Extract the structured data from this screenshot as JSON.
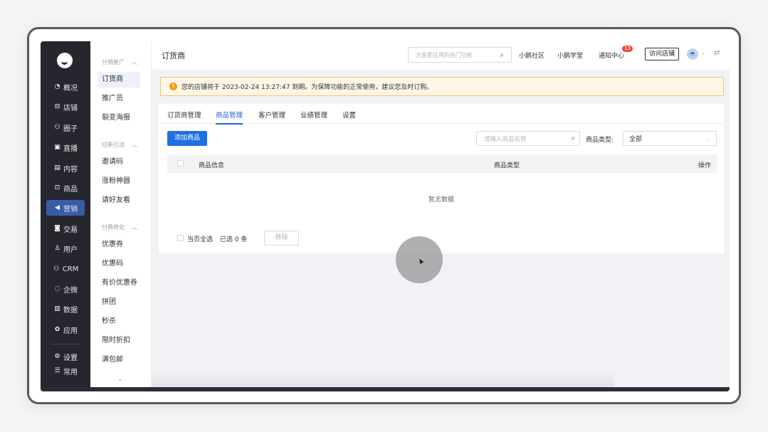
{
  "nav": {
    "items": [
      {
        "icon": "◔",
        "label": "概况"
      },
      {
        "icon": "⊟",
        "label": "店铺"
      },
      {
        "icon": "⚇",
        "label": "圈子"
      },
      {
        "icon": "▣",
        "label": "直播"
      },
      {
        "icon": "▤",
        "label": "内容"
      },
      {
        "icon": "⊡",
        "label": "商品"
      },
      {
        "icon": "◀",
        "label": "营销"
      },
      {
        "icon": "◙",
        "label": "交易"
      },
      {
        "icon": "♙",
        "label": "用户"
      },
      {
        "icon": "⚇",
        "label": "CRM"
      },
      {
        "icon": "◌",
        "label": "企微"
      },
      {
        "icon": "▥",
        "label": "数据"
      },
      {
        "icon": "✿",
        "label": "应用"
      },
      {
        "icon": "⚙",
        "label": "设置"
      },
      {
        "icon": "☰",
        "label": "常用"
      }
    ],
    "active_index": 6
  },
  "submenu": {
    "groups": [
      {
        "title": "分销推广",
        "items": [
          "订货商",
          "推广员",
          "裂变海报"
        ]
      },
      {
        "title": "拉新引流",
        "items": [
          "邀请码",
          "涨粉神器",
          "请好友看"
        ]
      },
      {
        "title": "付费转化",
        "items": [
          "优惠券",
          "优惠码",
          "有价优惠券",
          "拼团",
          "秒杀",
          "限时折扣",
          "满包邮"
        ]
      }
    ],
    "active": "订货商",
    "more_icon": "⌄"
  },
  "header": {
    "title": "订货商",
    "search_placeholder": "大家都在用的热门功能",
    "links": [
      "小鹅社区",
      "小鹅学堂",
      "通知中心"
    ],
    "notice_count": "13",
    "visit_store": "访问店铺"
  },
  "notice": {
    "text": "您的店铺将于 2023-02-24 13:27:47 到期。为保障功能的正常使用，建议您及时订购。",
    "icon": "!"
  },
  "tabs": [
    "订货商管理",
    "商品管理",
    "客户管理",
    "业绩管理",
    "设置"
  ],
  "active_tab": "商品管理",
  "toolbar": {
    "add_label": "添加商品",
    "search_placeholder": "请输入商品名称",
    "type_label": "商品类型:",
    "type_value": "全部"
  },
  "table": {
    "columns": [
      "商品信息",
      "商品类型",
      "操作"
    ],
    "empty_text": "暂无数据"
  },
  "footer": {
    "select_all": "当页全选",
    "selected_text": "已选 0 条",
    "remove_label": "移除"
  },
  "colors": {
    "sidebar_bg": "#26272e",
    "primary": "#1f6fe0",
    "warning_bg": "#fff6e6",
    "warning_border": "#f5c26b"
  }
}
